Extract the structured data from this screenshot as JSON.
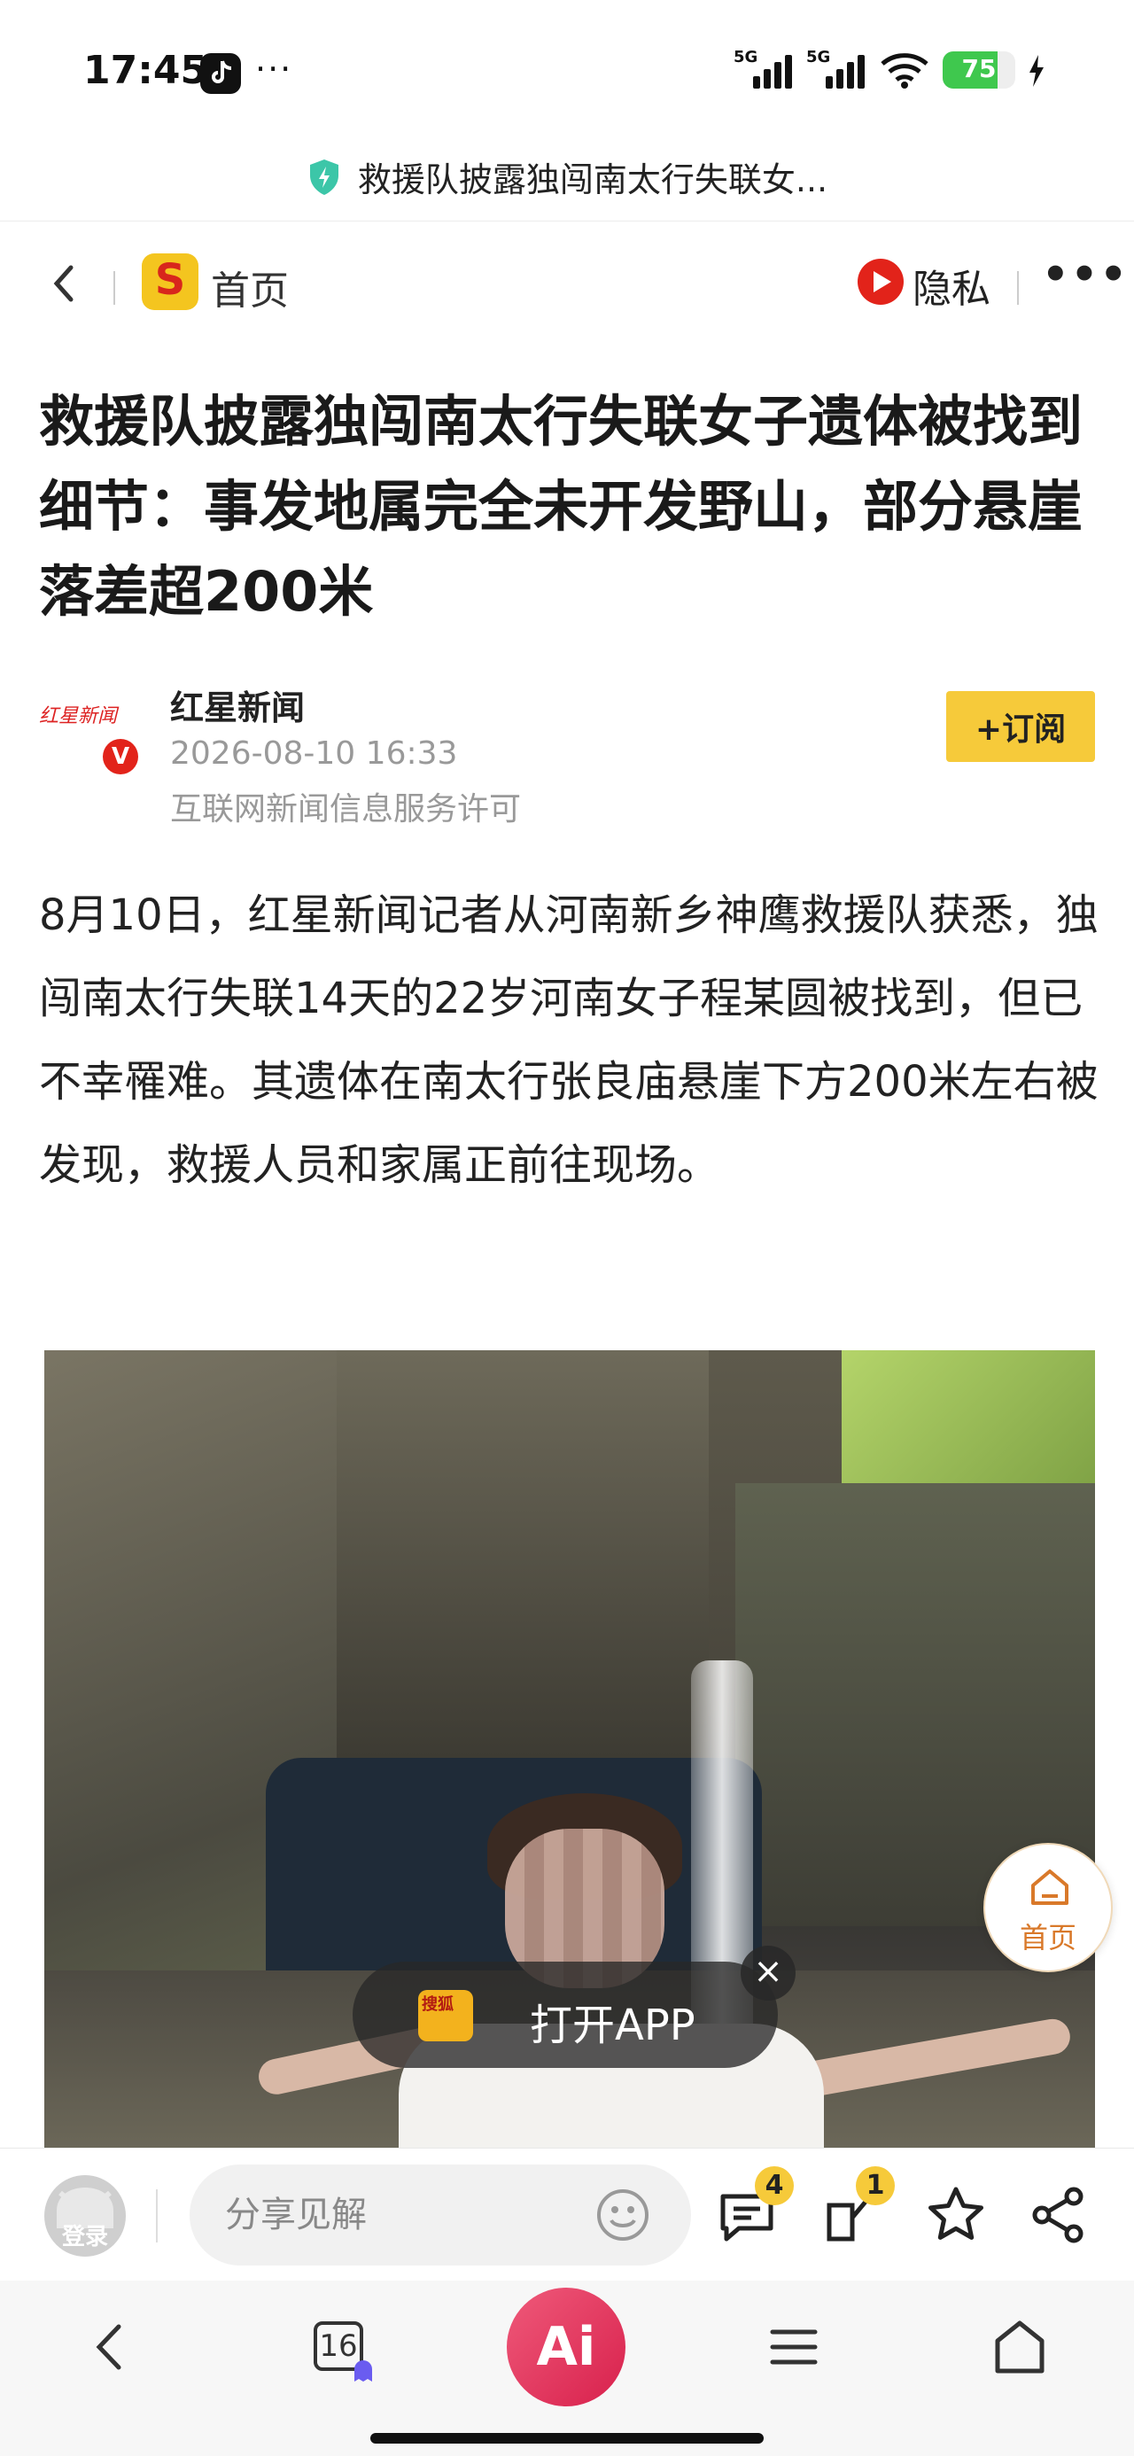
{
  "status_bar": {
    "time": "17:45",
    "network1": "5G",
    "network2": "5G",
    "battery_level": "75",
    "battery_percent": 75
  },
  "url_bar": {
    "title": "救援队披露独闯南太行失联女..."
  },
  "nav": {
    "home_label": "首页",
    "logo_letter": "S",
    "privacy_label": "隐私",
    "more_label": "•••"
  },
  "article": {
    "title": "救援队披露独闯南太行失联女子遗体被找到细节：事发地属完全未开发野山，部分悬崖落差超200米",
    "author": {
      "logo_text": "红星新闻",
      "verified": "V",
      "name": "红星新闻",
      "time": "2026-08-10 16:33",
      "license": "互联网新闻信息服务许可"
    },
    "subscribe_label": "+订阅",
    "body": "8月10日，红星新闻记者从河南新乡神鹰救援队获悉，独闯南太行失联14天的22岁河南女子程某圆被找到，但已不幸罹难。其遗体在南太行张良庙悬崖下方200米左右被发现，救援人员和家属正前往现场。"
  },
  "float_home": {
    "label": "首页"
  },
  "open_app": {
    "logo_text": "搜狐",
    "label": "打开APP",
    "close": "×"
  },
  "comment_bar": {
    "login_label": "登录",
    "placeholder": "分享见解",
    "comments_count": "4",
    "reposts_count": "1"
  },
  "browser_nav": {
    "tabs_count": "16",
    "ai_label": "Ai"
  },
  "colors": {
    "accent_yellow": "#f6ca3a",
    "brand_red": "#e2231a",
    "battery_green": "#3fc84e"
  }
}
